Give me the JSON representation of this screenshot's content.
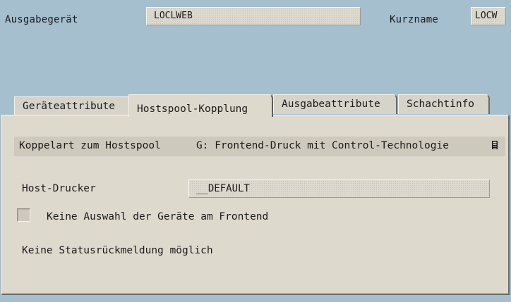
{
  "header": {
    "device_label": "Ausgabegerät",
    "device_value": "LOCLWEB",
    "shortname_label": "Kurzname",
    "shortname_value": "LOCW"
  },
  "tabs": [
    {
      "label": "Geräteattribute",
      "active": false
    },
    {
      "label": "Hostspool-Kopplung",
      "active": true
    },
    {
      "label": "Ausgabeattribute",
      "active": false
    },
    {
      "label": "Schachtinfo",
      "active": false
    }
  ],
  "panel": {
    "coupling_label": "Koppelart zum Hostspool",
    "coupling_value": "G: Frontend-Druck mit Control-Technologie",
    "host_printer_label": "Host-Drucker",
    "host_printer_value": "__DEFAULT",
    "checkbox_label": "Keine Auswahl der Geräte am Frontend",
    "checkbox_checked": false,
    "status_note": "Keine Statusrückmeldung möglich"
  },
  "icons": {
    "dropdown": "list-selection-icon"
  }
}
